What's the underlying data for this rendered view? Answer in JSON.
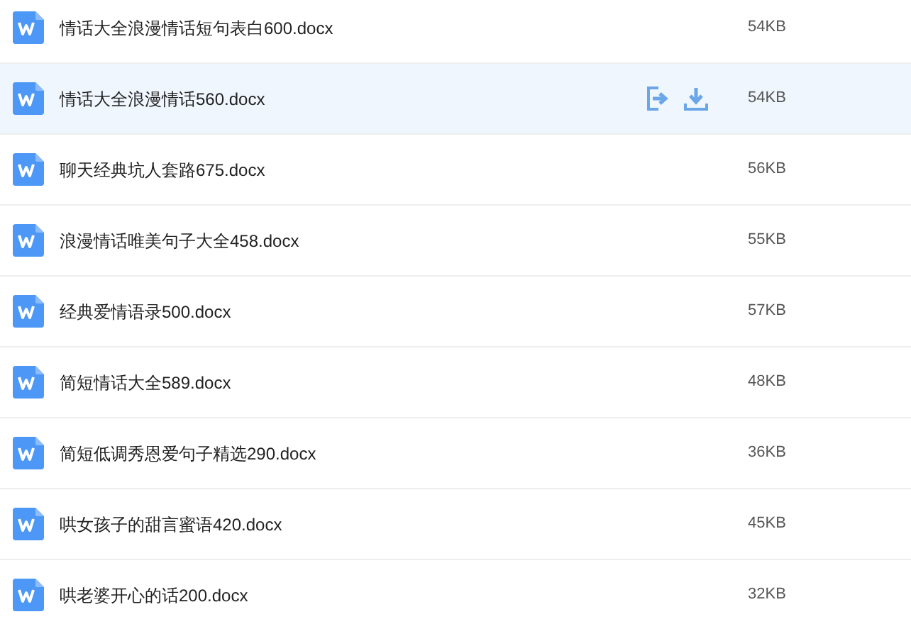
{
  "files": [
    {
      "name": "情话大全浪漫情话短句表白600.docx",
      "size": "54KB",
      "selected": false
    },
    {
      "name": "情话大全浪漫情话560.docx",
      "size": "54KB",
      "selected": true
    },
    {
      "name": "聊天经典坑人套路675.docx",
      "size": "56KB",
      "selected": false
    },
    {
      "name": "浪漫情话唯美句子大全458.docx",
      "size": "55KB",
      "selected": false
    },
    {
      "name": "经典爱情语录500.docx",
      "size": "57KB",
      "selected": false
    },
    {
      "name": "简短情话大全589.docx",
      "size": "48KB",
      "selected": false
    },
    {
      "name": "简短低调秀恩爱句子精选290.docx",
      "size": "36KB",
      "selected": false
    },
    {
      "name": "哄女孩子的甜言蜜语420.docx",
      "size": "45KB",
      "selected": false
    },
    {
      "name": "哄老婆开心的话200.docx",
      "size": "32KB",
      "selected": false
    }
  ]
}
